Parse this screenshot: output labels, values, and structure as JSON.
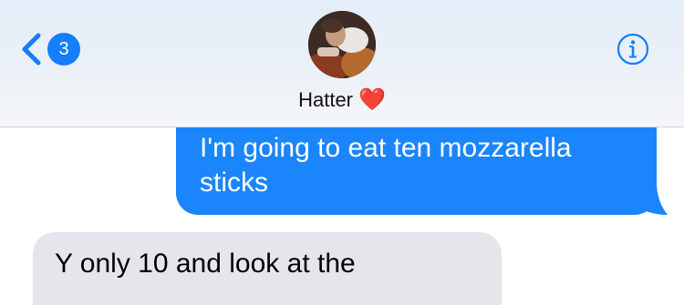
{
  "header": {
    "back_count": "3",
    "contact_name": "Hatter",
    "contact_emoji": "❤️",
    "icons": {
      "back": "chevron-left-icon",
      "info": "info-icon"
    }
  },
  "messages": [
    {
      "direction": "sent",
      "text": "I'm going to eat ten mozzarella sticks"
    },
    {
      "direction": "received",
      "text": "Y only 10 and look at the"
    }
  ],
  "colors": {
    "accent": "#147efb",
    "sent_bubble": "#1b85fb",
    "received_bubble": "#e6e5eb",
    "heart": "#d0021b"
  }
}
